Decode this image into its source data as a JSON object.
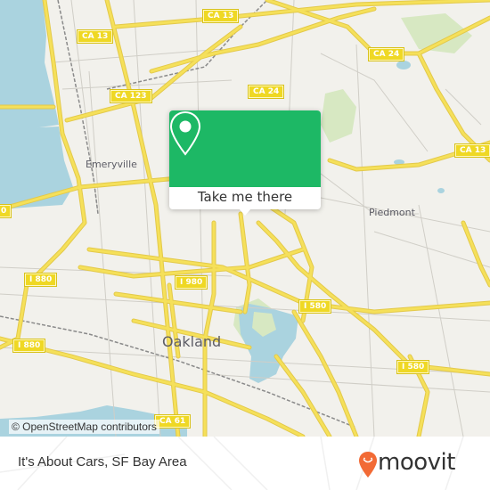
{
  "map": {
    "colors": {
      "land": "#f2f1ec",
      "water": "#aad3df",
      "park": "#d7e8c2",
      "road_major": "#f5e05a",
      "road_casing": "#e3c94a",
      "road_minor": "#c9c7c0",
      "rail": "#8a8a8a",
      "shield": "#efd824"
    },
    "shields": [
      {
        "label": "CA 13"
      },
      {
        "label": "CA 13"
      },
      {
        "label": "CA 123"
      },
      {
        "label": "CA 24"
      },
      {
        "label": "CA 24"
      },
      {
        "label": "CA 13"
      },
      {
        "label": "I 880"
      },
      {
        "label": "I 880"
      },
      {
        "label": "I 980"
      },
      {
        "label": "I 580"
      },
      {
        "label": "I 580"
      },
      {
        "label": "0"
      },
      {
        "label": "CA 61"
      }
    ],
    "places": [
      {
        "label": "Emeryville"
      },
      {
        "label": "Piedmont"
      },
      {
        "label": "Oakland"
      }
    ],
    "attribution": "© OpenStreetMap contributors"
  },
  "popup": {
    "action_label": "Take me there",
    "icon": "map-pin-icon",
    "color": "#1db865"
  },
  "footer": {
    "place_name": "It's About Cars, SF Bay Area",
    "brand": {
      "name": "moovit",
      "icon": "moovit-logo-pin-icon",
      "color": "#f26a35"
    }
  }
}
